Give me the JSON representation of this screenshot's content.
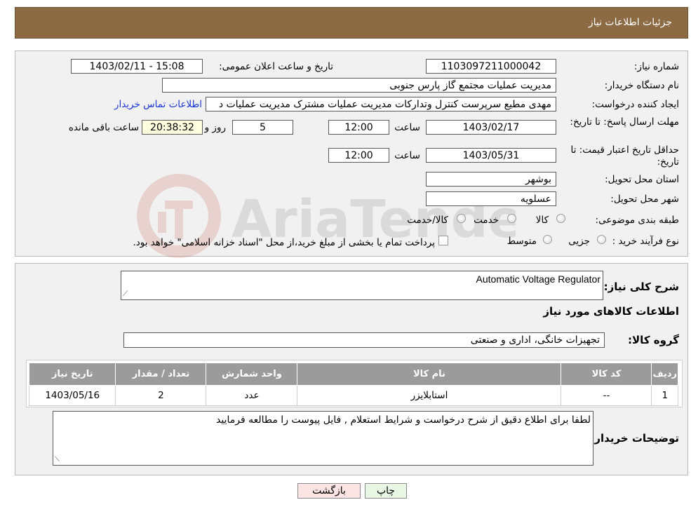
{
  "header": {
    "title": "جزئیات اطلاعات نیاز"
  },
  "form": {
    "need_number_label": "شماره نیاز:",
    "need_number": "1103097211000042",
    "announce_label": "تاریخ و ساعت اعلان عمومی:",
    "announce_value": "1403/02/11 - 15:08",
    "buyer_org_label": "نام دستگاه خریدار:",
    "buyer_org": "مدیریت عملیات مجتمع گاز پارس جنوبی",
    "requester_label": "ایجاد کننده درخواست:",
    "requester": "مهدی مطیع سرپرست کنترل وتدارکات مدیریت عملیات مشترک مدیریت عملیات د",
    "contact_link": "اطلاعات تماس خریدار",
    "reply_deadline_label": "مهلت ارسال پاسخ: تا تاریخ:",
    "reply_date": "1403/02/17",
    "time_label": "ساعت",
    "reply_time": "12:00",
    "days_value": "5",
    "days_label": "روز و",
    "remaining_time": "20:38:32",
    "remaining_label": "ساعت باقی مانده",
    "price_validity_label": "حداقل تاریخ اعتبار قیمت: تا تاریخ:",
    "price_date": "1403/05/31",
    "price_time": "12:00",
    "province_label": "استان محل تحویل:",
    "province": "بوشهر",
    "city_label": "شهر محل تحویل:",
    "city": "عسلویه",
    "category_label": "طبقه بندی موضوعی:",
    "category_options": [
      "کالا",
      "خدمت",
      "کالا/خدمت"
    ],
    "process_label": "نوع فرآیند خرید :",
    "process_options": [
      "جزیی",
      "متوسط"
    ],
    "payment_note": "پرداخت تمام یا بخشی از مبلغ خرید،از محل \"اسناد خزانه اسلامی\" خواهد بود."
  },
  "details": {
    "summary_label": "شرح کلی نیاز:",
    "summary_value": "Automatic Voltage Regulator",
    "goods_info_title": "اطلاعات کالاهای مورد نیاز",
    "goods_group_label": "گروه کالا:",
    "goods_group_value": "تجهیزات خانگی، اداری و صنعتی",
    "table": {
      "headers": [
        "ردیف",
        "کد کالا",
        "نام کالا",
        "واحد شمارش",
        "تعداد / مقدار",
        "تاریخ نیاز"
      ],
      "rows": [
        [
          "1",
          "--",
          "استابلایزر",
          "عدد",
          "2",
          "1403/05/16"
        ]
      ]
    },
    "buyer_notes_label": "توضیحات خریدار:",
    "buyer_notes_value": "لطفا برای اطلاع دقیق از شرح درخواست و شرایط استعلام , فایل پیوست را مطالعه فرمایید"
  },
  "buttons": {
    "print": "چاپ",
    "back": "بازگشت"
  },
  "watermark": {
    "text": "AriaTender.neT"
  },
  "colors": {
    "header_bg": "#8b6a44",
    "panel_bg": "#f1f1f1",
    "table_header_bg": "#9b9b9b",
    "link": "#1a37d6",
    "back_btn_bg": "#fde4e4",
    "print_btn_bg": "#e8f6e4"
  }
}
